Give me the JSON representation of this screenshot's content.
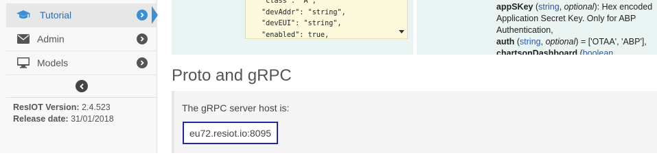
{
  "sidebar": {
    "items": [
      {
        "label": "Tutorial",
        "icon": "graduation-cap-icon",
        "active": true
      },
      {
        "label": "Admin",
        "icon": "envelope-icon",
        "active": false
      },
      {
        "label": "Models",
        "icon": "monitor-icon",
        "active": false
      }
    ],
    "version_label": "ResIOT Version:",
    "version_value": "2.4.523",
    "release_label": "Release date:",
    "release_value": "31/01/2018"
  },
  "code_sample": {
    "lines": [
      "\"class\": \"A\",",
      "\"devAddr\": \"string\",",
      "\"devEUI\": \"string\",",
      "\"enabled\": true,"
    ]
  },
  "description": {
    "field1_name": "appSKey",
    "field1_open": " (",
    "field1_type": "string",
    "field1_sep": ", ",
    "field1_optional": "optional",
    "field1_close": "): Hex encoded Application Secret Key. Only for ABP Authentication,",
    "field2_name": "auth",
    "field2_open": " (",
    "field2_type": "string",
    "field2_sep": ", ",
    "field2_optional": "optional",
    "field2_close": ") = ['OTAA', 'ABP'],",
    "field3_name": "chartsonDashboard",
    "field3_open": " (",
    "field3_type": "boolean"
  },
  "section": {
    "title": "Proto and gRPC",
    "host_label": "The gRPC server host is:",
    "host_value": "eu72.resiot.io:8095"
  },
  "colors": {
    "accent": "#3a8fd6",
    "host_border": "#1f2aa0",
    "panel_bg": "#eaf5f3",
    "code_bg": "#fdf9dc"
  }
}
